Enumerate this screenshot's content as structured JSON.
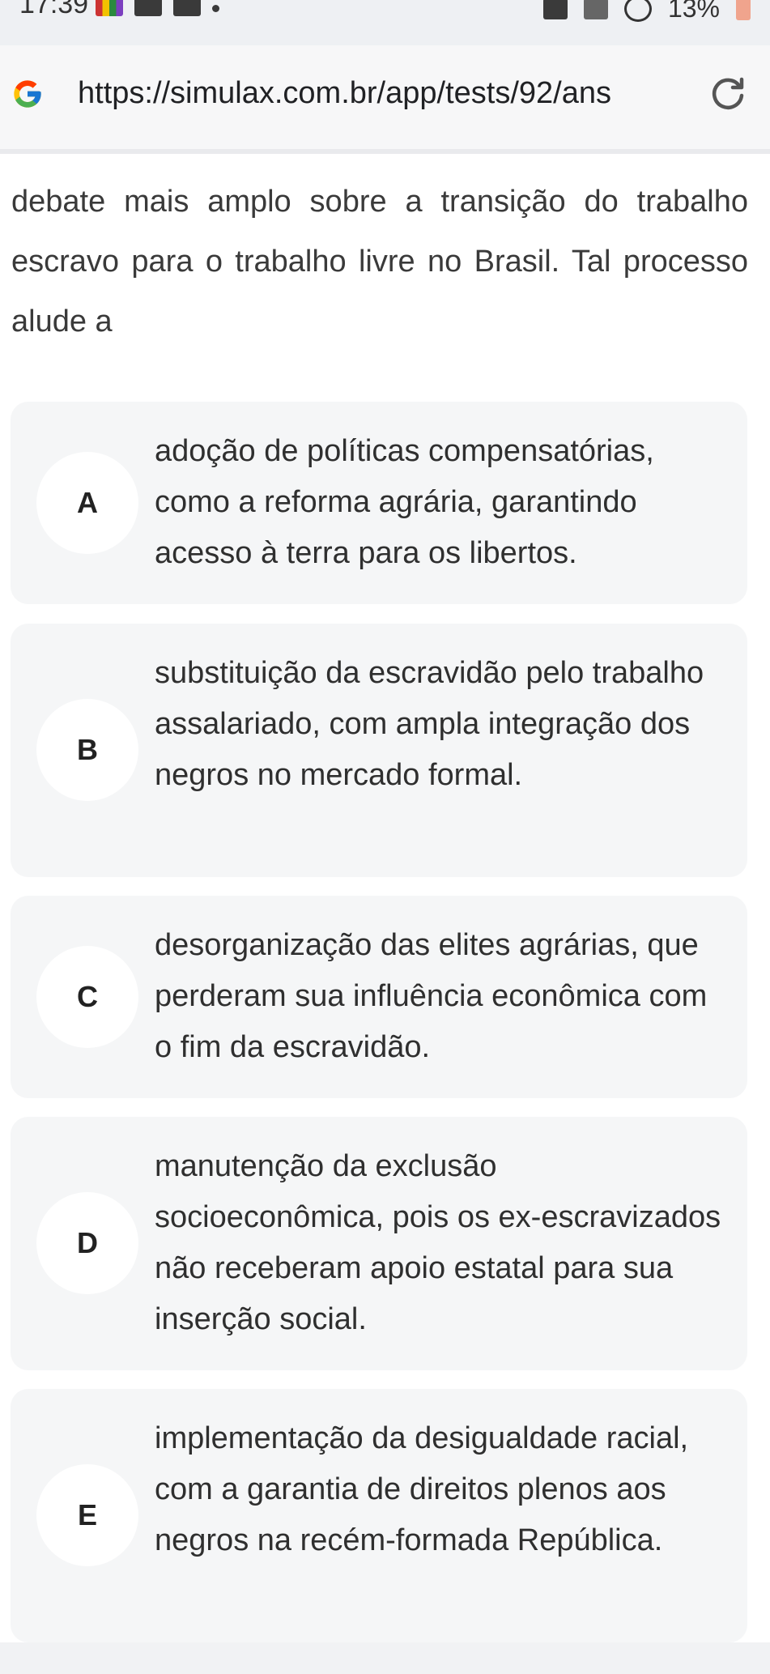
{
  "status_bar": {
    "time": "17:39",
    "battery": "13%"
  },
  "browser": {
    "url": "https://simulax.com.br/app/tests/92/ans",
    "logo_icon": "google-g-icon",
    "reload_icon": "reload-icon"
  },
  "question": {
    "text": "debate mais amplo sobre a transição do trabalho escravo para o trabalho livre no Brasil. Tal processo alude a"
  },
  "options": [
    {
      "letter": "A",
      "text": "adoção de políticas compensatórias, como a reforma agrária, garantindo acesso à terra para os libertos."
    },
    {
      "letter": "B",
      "text": "substituição da escravidão pelo trabalho assalariado, com ampla integração dos negros no mercado formal."
    },
    {
      "letter": "C",
      "text": "desorganização das elites agrárias, que perderam sua influência econômica com o fim da escravidão."
    },
    {
      "letter": "D",
      "text": "manutenção da exclusão socioeconômica, pois os ex-escravizados não receberam apoio estatal para sua inserção social."
    },
    {
      "letter": "E",
      "text": "implementação da desigualdade racial, com a garantia de direitos plenos aos negros na recém-formada República."
    }
  ]
}
